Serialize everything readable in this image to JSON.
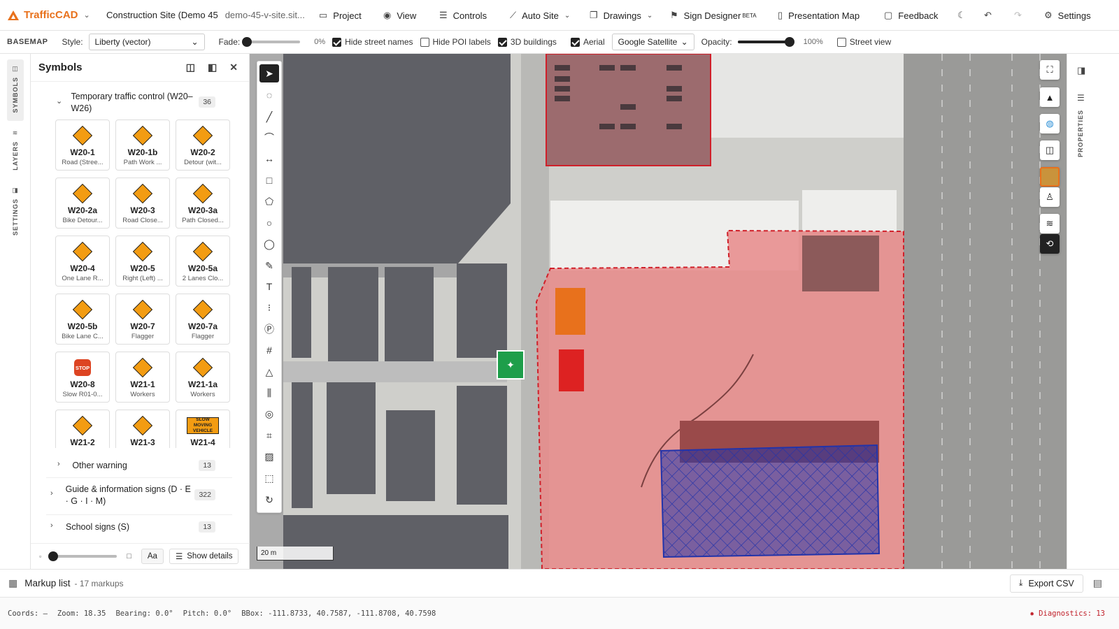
{
  "app": {
    "name": "TrafficCAD",
    "project": "Construction Site (Demo 45",
    "project_url": "demo-45-v-site.sit..."
  },
  "nav": {
    "project": "Project",
    "view": "View",
    "controls": "Controls",
    "auto_site": "Auto Site",
    "drawings": "Drawings",
    "sign_designer": "Sign Designer",
    "sign_designer_badge": "BETA",
    "presentation_map": "Presentation Map",
    "feedback": "Feedback",
    "settings": "Settings"
  },
  "basemap": {
    "label": "BASEMAP",
    "style_label": "Style:",
    "style_value": "Liberty (vector)",
    "fade_label": "Fade:",
    "fade_value": "0%",
    "fade_level": 0,
    "hide_street_names": "Hide street names",
    "hide_street_names_checked": true,
    "hide_poi_labels": "Hide POI labels",
    "hide_poi_labels_checked": false,
    "buildings_3d": "3D buildings",
    "buildings_3d_checked": true,
    "aerial": "Aerial",
    "aerial_checked": true,
    "aerial_source": "Google Satellite",
    "opacity_label": "Opacity:",
    "opacity_value": "100%",
    "opacity_level": 1,
    "street_view": "Street view",
    "street_view_checked": false
  },
  "rail": {
    "symbols": "SYMBOLS",
    "layers": "LAYERS",
    "settings": "SETTINGS"
  },
  "panel": {
    "title": "Symbols",
    "group_open": {
      "title": "Temporary traffic control (W20–W26)",
      "count": "36"
    },
    "signs": [
      {
        "code": "W20-1",
        "desc": "Road (Stree..."
      },
      {
        "code": "W20-1b",
        "desc": "Path Work ..."
      },
      {
        "code": "W20-2",
        "desc": "Detour (wit..."
      },
      {
        "code": "W20-2a",
        "desc": "Bike Detour..."
      },
      {
        "code": "W20-3",
        "desc": "Road Close..."
      },
      {
        "code": "W20-3a",
        "desc": "Path Closed..."
      },
      {
        "code": "W20-4",
        "desc": "One Lane R..."
      },
      {
        "code": "W20-5",
        "desc": "Right (Left) ..."
      },
      {
        "code": "W20-5a",
        "desc": "2 Lanes Clo..."
      },
      {
        "code": "W20-5b",
        "desc": "Bike Lane C..."
      },
      {
        "code": "W20-7",
        "desc": "Flagger"
      },
      {
        "code": "W20-7a",
        "desc": "Flagger"
      },
      {
        "code": "W20-8",
        "desc": "Slow R01-0...",
        "glyph_text": "STOP"
      },
      {
        "code": "W21-1",
        "desc": "Workers"
      },
      {
        "code": "W21-1a",
        "desc": "Workers"
      },
      {
        "code": "W21-2",
        "desc": ""
      },
      {
        "code": "W21-3",
        "desc": ""
      },
      {
        "code": "W21-4",
        "desc": "",
        "glyph_text": "SLOW MOVING VEHICLE"
      }
    ],
    "group_other": {
      "title": "Other warning",
      "count": "13"
    },
    "group_guide": {
      "title": "Guide & information signs (D · E · G · I · M)",
      "count": "322"
    },
    "group_school": {
      "title": "School signs (S)",
      "count": "13"
    },
    "font_toggle": "Aa",
    "show_details": "Show details"
  },
  "map": {
    "scale": "20 m"
  },
  "properties": {
    "label": "PROPERTIES"
  },
  "markup": {
    "title": "Markup list",
    "count": "- 17 markups",
    "export": "Export CSV"
  },
  "status": {
    "coords": "Coords: —",
    "zoom": "Zoom: 18.35",
    "bearing": "Bearing: 0.0°",
    "pitch": "Pitch: 0.0°",
    "bbox": "BBox: -111.8733, 40.7587, -111.8708, 40.7598",
    "diagnostics": "Diagnostics: 13"
  },
  "colors": {
    "accent": "#e8711c",
    "site_fill": "#e88a8a",
    "site_border": "#d0202a",
    "hatch": "#2233aa",
    "diag": "#c0202a"
  }
}
